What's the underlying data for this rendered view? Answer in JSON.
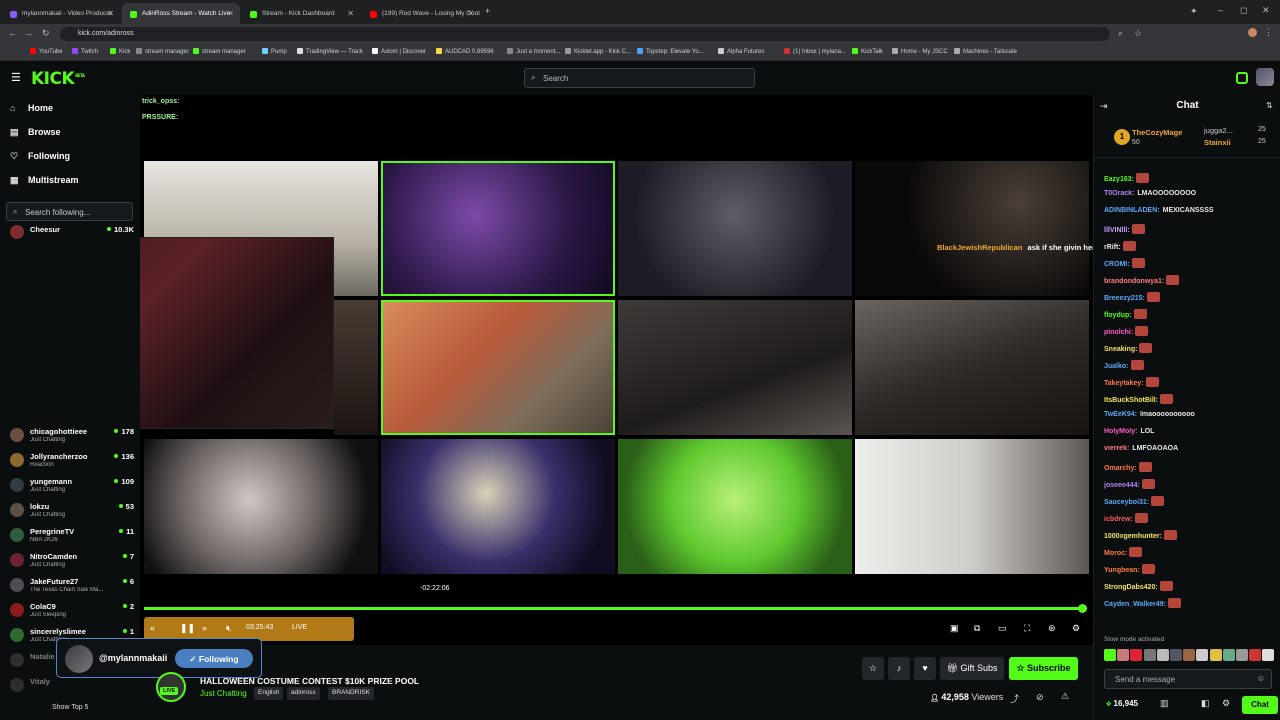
{
  "browser": {
    "tabs": [
      {
        "label": "mylannmakaii - Video Producer",
        "color": "#8b5cf6"
      },
      {
        "label": "AdinRoss Stream - Watch Live",
        "color": "#53fc18"
      },
      {
        "label": "Stream - Kick Dashboard",
        "color": "#53fc18"
      },
      {
        "label": "(199) Rod Wave - Losing My Cool",
        "color": "#ff0000"
      }
    ],
    "url": "kick.com/adinross",
    "bookmarks": [
      "YouTube",
      "Twitch",
      "Kick",
      "stream manager",
      "stream manager",
      "Pump",
      "TradingView — Track",
      "Axiom | Discover",
      "AUDCAD 0.89596",
      "Just a moment...",
      "Kicklet.app - Kick C...",
      "Topstep: Elevate Yo...",
      "Alpha Futures",
      "(1) Inbox | mylana...",
      "KickTalk",
      "Home - My JSCC",
      "Machines - Tailscale"
    ]
  },
  "kick": {
    "logo": "KICK",
    "logo_sup": "BETA",
    "search_placeholder": "Search"
  },
  "sidebar": {
    "nav": [
      {
        "label": "Home",
        "icon": "home-icon",
        "glyph": "⌂"
      },
      {
        "label": "Browse",
        "icon": "browse-icon",
        "glyph": "▤"
      },
      {
        "label": "Following",
        "icon": "heart-icon",
        "glyph": "♡"
      },
      {
        "label": "Multistream",
        "icon": "grid-icon",
        "glyph": "▦"
      }
    ],
    "following_search_placeholder": "Search following...",
    "top_channel": {
      "name": "Cheesur",
      "viewers": "10.3K"
    },
    "channels": [
      {
        "name": "chicagohottieee",
        "category": "Just Chatting",
        "viewers": "178",
        "color": "#6b4f3f"
      },
      {
        "name": "Jollyrancherzoo",
        "category": "Reaction",
        "viewers": "136",
        "color": "#8a6a2f"
      },
      {
        "name": "yungemann",
        "category": "Just Chatting",
        "viewers": "109",
        "color": "#333b44"
      },
      {
        "name": "lokzu",
        "category": "Just Chatting",
        "viewers": "53",
        "color": "#5d5145"
      },
      {
        "name": "PeregrineTV",
        "category": "NBA 2K26",
        "viewers": "11",
        "color": "#2e5f3a"
      },
      {
        "name": "NitroCamden",
        "category": "Just Chatting",
        "viewers": "7",
        "color": "#6a2430"
      },
      {
        "name": "JakeFuture27",
        "category": "The Texas Chain Saw Ma...",
        "viewers": "6",
        "color": "#4d4d55"
      },
      {
        "name": "ColaC9",
        "category": "Just Sleeping",
        "viewers": "2",
        "color": "#8b1d1d"
      },
      {
        "name": "sincerelyslimee",
        "category": "Just Chatting",
        "viewers": "1",
        "color": "#2f6b2f"
      },
      {
        "name": "Natalie",
        "category": "",
        "viewers": "",
        "color": "#555"
      },
      {
        "name": "Vitaly",
        "category": "",
        "viewers": "",
        "color": "#555"
      }
    ],
    "show_top": "Show Top 5"
  },
  "player": {
    "overlay_chat": [
      "trick_opss:",
      "PRSSURE:",
      "",
      ""
    ],
    "superchat_user": "BlackJewishRepublican",
    "superchat_text": "ask if she givin her loyal divas tips",
    "time_tooltip": "-02:22:06",
    "elapsed": "03:25:43",
    "live_label": "LIVE",
    "progress": 0.995
  },
  "follow_bubble": {
    "handle": "@mylannmakaii",
    "button": "Following"
  },
  "stream": {
    "title": "HALLOWEEN COSTUME CONTEST $10K PRIZE POOL",
    "category": "Just Chatting",
    "tags": [
      "English",
      "adinross",
      "BRANDRISK"
    ],
    "live": "LIVE",
    "gift_subs": "Gift Subs",
    "subscribe": "Subscribe",
    "viewers": "42,958",
    "viewers_label": "Viewers"
  },
  "chat": {
    "title": "Chat",
    "gifters": [
      {
        "name": "TheCozyMage",
        "count": "50"
      },
      {
        "name": "jugga2...",
        "count": "25"
      },
      {
        "name": "Stainxii",
        "count": "25"
      }
    ],
    "messages": [
      {
        "user": "Eazy163:",
        "text": "",
        "color": "#53fc18",
        "emote": true
      },
      {
        "user": "T0Orack:",
        "text": "LMAOOOOOOOO",
        "color": "#b084f5",
        "emote": false
      },
      {
        "user": "ADINBINLADEN:",
        "text": "MEXICANSSSS",
        "color": "#5aa9f5",
        "emote": false
      },
      {
        "user": "lllVINlll:",
        "text": "",
        "color": "#c6a0ff",
        "emote": true
      },
      {
        "user": "rRift:",
        "text": "",
        "color": "#e8e8e8",
        "emote": true
      },
      {
        "user": "CROMI:",
        "text": "",
        "color": "#5aa9f5",
        "emote": true
      },
      {
        "user": "brandondonwya1:",
        "text": "",
        "color": "#ff7a7a",
        "emote": true
      },
      {
        "user": "Breeezy215:",
        "text": "",
        "color": "#5aa9f5",
        "emote": true
      },
      {
        "user": "floydup:",
        "text": "",
        "color": "#53fc18",
        "emote": true
      },
      {
        "user": "pinolchi:",
        "text": "",
        "color": "#ff5ac8",
        "emote": true
      },
      {
        "user": "Sneaking:",
        "text": "",
        "color": "#f5e35a",
        "emote": true
      },
      {
        "user": "Jualko:",
        "text": "",
        "color": "#5aa9f5",
        "emote": true
      },
      {
        "user": "Takeytakey:",
        "text": "",
        "color": "#ff7a3d",
        "emote": true
      },
      {
        "user": "ItsBuckShotBill:",
        "text": "",
        "color": "#f5e35a",
        "emote": true
      },
      {
        "user": "TwEeK94:",
        "text": "lmaoooooooooo",
        "color": "#5aa9f5",
        "emote": false
      },
      {
        "user": "HolyMoly:",
        "text": "LOL",
        "color": "#ff5ac8",
        "emote": false
      },
      {
        "user": "vierrek:",
        "text": "LMFOAOAOA",
        "color": "#ff7a7a",
        "emote": false
      },
      {
        "user": "Omarchy:",
        "text": "",
        "color": "#ff7a3d",
        "emote": true
      },
      {
        "user": "joseee444:",
        "text": "",
        "color": "#b084f5",
        "emote": true
      },
      {
        "user": "Sauceyboi31:",
        "text": "",
        "color": "#5aa9f5",
        "emote": true
      },
      {
        "user": "icbdrew:",
        "text": "",
        "color": "#ff5a5a",
        "emote": true
      },
      {
        "user": "1000xgemhunter:",
        "text": "",
        "color": "#f5e35a",
        "emote": true
      },
      {
        "user": "Moroc:",
        "text": "",
        "color": "#ff7a3d",
        "emote": true
      },
      {
        "user": "Yungbean:",
        "text": "",
        "color": "#ff7a3d",
        "emote": true
      },
      {
        "user": "StrongDabs420:",
        "text": "",
        "color": "#f5e35a",
        "emote": true
      },
      {
        "user": "Cayden_Walker49:",
        "text": "",
        "color": "#5aa9f5",
        "emote": true
      }
    ],
    "slow_mode": "Slow mode activated",
    "send_placeholder": "Send a message",
    "points": "16,945",
    "chat_button": "Chat"
  },
  "colors": {
    "brand": "#53fc18",
    "bg": "#0b0e0f"
  }
}
